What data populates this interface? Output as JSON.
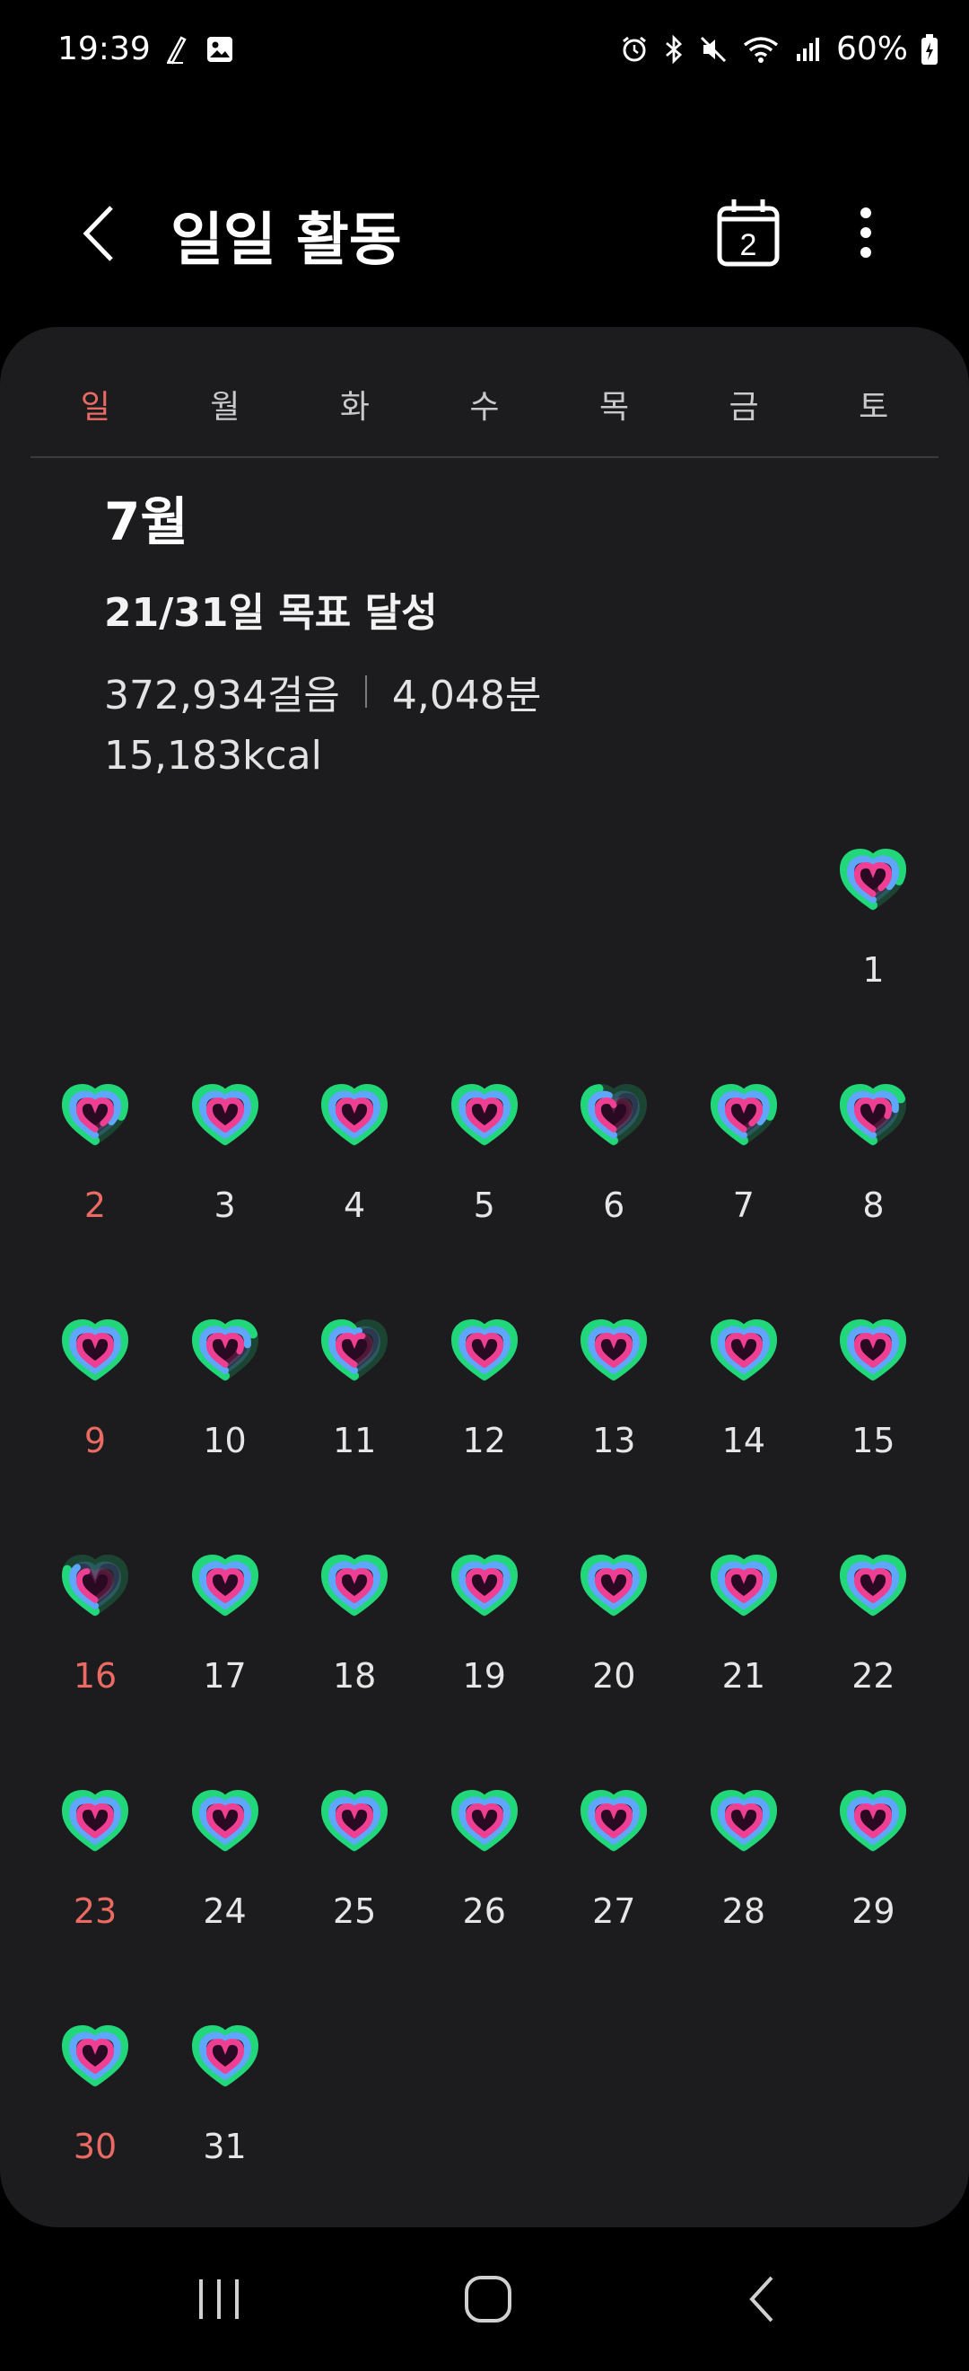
{
  "status_bar": {
    "time": "19:39",
    "battery": "60%",
    "icons": [
      "pen-icon",
      "image-icon",
      "alarm-icon",
      "bluetooth-icon",
      "mute-icon",
      "wifi-icon",
      "signal-icon",
      "battery-icon"
    ]
  },
  "header": {
    "title": "일일 활동",
    "calendar_day": "2"
  },
  "weekdays": [
    "일",
    "월",
    "화",
    "수",
    "목",
    "금",
    "토"
  ],
  "summary": {
    "month": "7월",
    "goal": "21/31일 목표 달성",
    "steps": "372,934걸음",
    "minutes": "4,048분",
    "calories": "15,183kcal"
  },
  "calendar": {
    "first_weekday_index": 6,
    "days": [
      {
        "day": "1",
        "progress": 0.8
      },
      {
        "day": "2",
        "progress": 0.8
      },
      {
        "day": "3",
        "progress": 1.0
      },
      {
        "day": "4",
        "progress": 1.0
      },
      {
        "day": "5",
        "progress": 1.0
      },
      {
        "day": "6",
        "progress": 0.4
      },
      {
        "day": "7",
        "progress": 0.8
      },
      {
        "day": "8",
        "progress": 0.7
      },
      {
        "day": "9",
        "progress": 1.0
      },
      {
        "day": "10",
        "progress": 0.7
      },
      {
        "day": "11",
        "progress": 0.5
      },
      {
        "day": "12",
        "progress": 1.0
      },
      {
        "day": "13",
        "progress": 1.0
      },
      {
        "day": "14",
        "progress": 1.0
      },
      {
        "day": "15",
        "progress": 1.0
      },
      {
        "day": "16",
        "progress": 0.3
      },
      {
        "day": "17",
        "progress": 1.0
      },
      {
        "day": "18",
        "progress": 1.0
      },
      {
        "day": "19",
        "progress": 1.0
      },
      {
        "day": "20",
        "progress": 1.0
      },
      {
        "day": "21",
        "progress": 1.0
      },
      {
        "day": "22",
        "progress": 1.0
      },
      {
        "day": "23",
        "progress": 1.0
      },
      {
        "day": "24",
        "progress": 1.0
      },
      {
        "day": "25",
        "progress": 1.0
      },
      {
        "day": "26",
        "progress": 1.0
      },
      {
        "day": "27",
        "progress": 1.0
      },
      {
        "day": "28",
        "progress": 1.0
      },
      {
        "day": "29",
        "progress": 1.0
      },
      {
        "day": "30",
        "progress": 1.0
      },
      {
        "day": "31",
        "progress": 1.0
      }
    ]
  },
  "colors": {
    "sunday": "#ec6a64",
    "ring_outer": "#22d67a",
    "ring_middle": "#5ea6ff",
    "ring_inner": "#ef3f93",
    "card_bg": "#1c1c1e"
  }
}
